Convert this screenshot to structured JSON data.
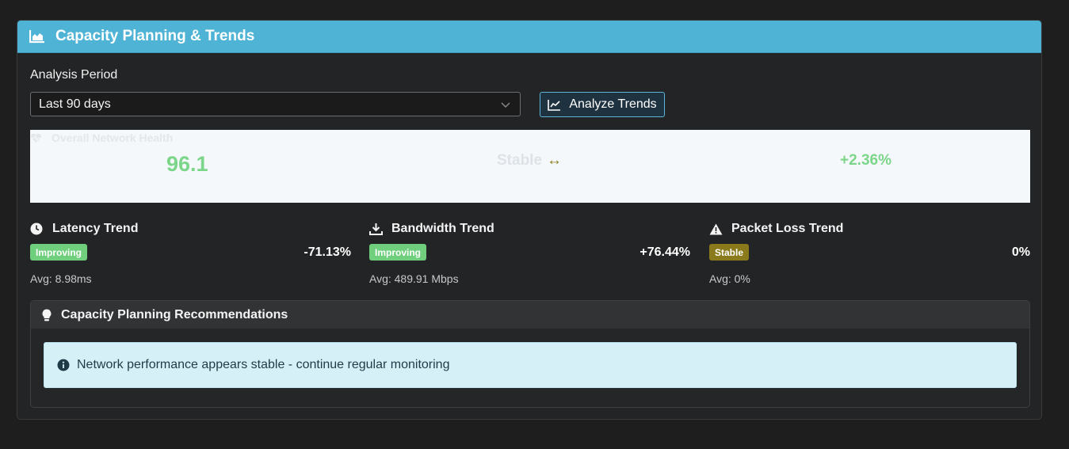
{
  "header": {
    "title": "Capacity Planning & Trends",
    "icon": "area-chart-icon",
    "color": "#4fb3d6"
  },
  "period": {
    "label": "Analysis Period",
    "selected": "Last 90 days",
    "icon": "chevron-down-icon"
  },
  "analyze_button": {
    "label": "Analyze Trends",
    "icon": "line-chart-icon"
  },
  "health": {
    "label": "Overall Network Health",
    "icon": "heart-pulse-icon",
    "score": "96.1",
    "status": "Stable",
    "status_arrow": "↔",
    "change": "+2.36%"
  },
  "trends": [
    {
      "title": "Latency Trend",
      "icon": "clock-icon",
      "badge": "Improving",
      "badge_color": "#6fcf7d",
      "pct": "-71.13%",
      "avg": "Avg: 8.98ms"
    },
    {
      "title": "Bandwidth Trend",
      "icon": "download-icon",
      "badge": "Improving",
      "badge_color": "#6fcf7d",
      "pct": "+76.44%",
      "avg": "Avg: 489.91 Mbps"
    },
    {
      "title": "Packet Loss Trend",
      "icon": "warning-icon",
      "badge": "Stable",
      "badge_color": "#8b7a1b",
      "pct": "0%",
      "avg": "Avg: 0%"
    }
  ],
  "recommendations": {
    "title": "Capacity Planning Recommendations",
    "icon": "lightbulb-icon",
    "message": "Network performance appears stable - continue regular monitoring",
    "message_icon": "info-icon"
  }
}
